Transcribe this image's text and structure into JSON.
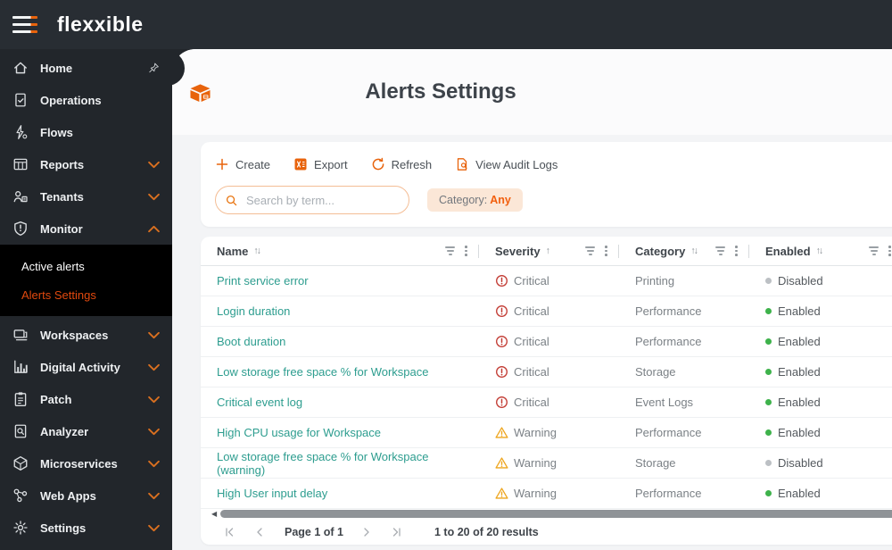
{
  "brand": {
    "logo": "flexxible"
  },
  "sidebar": {
    "primary": [
      {
        "label": "Home",
        "icon": "home",
        "right": "pin"
      },
      {
        "label": "Operations",
        "icon": "operations"
      },
      {
        "label": "Flows",
        "icon": "flows"
      },
      {
        "label": "Reports",
        "icon": "reports",
        "right": "chevron-down"
      },
      {
        "label": "Tenants",
        "icon": "tenants",
        "right": "chevron-down"
      },
      {
        "label": "Monitor",
        "icon": "shield",
        "right": "chevron-up"
      }
    ],
    "submenu": [
      {
        "label": "Active alerts",
        "state": "normal"
      },
      {
        "label": "Alerts Settings",
        "state": "active"
      }
    ],
    "secondary": [
      {
        "label": "Workspaces",
        "icon": "workspaces",
        "right": "chevron-down"
      },
      {
        "label": "Digital Activity",
        "icon": "digital-activity",
        "right": "chevron-down"
      },
      {
        "label": "Patch",
        "icon": "patch",
        "right": "chevron-down"
      },
      {
        "label": "Analyzer",
        "icon": "analyzer",
        "right": "chevron-down"
      },
      {
        "label": "Microservices",
        "icon": "microservices",
        "right": "chevron-down"
      },
      {
        "label": "Web Apps",
        "icon": "web-apps",
        "right": "chevron-down"
      },
      {
        "label": "Settings",
        "icon": "settings",
        "right": "chevron-down"
      }
    ]
  },
  "header": {
    "title": "Alerts Settings",
    "icon": "package"
  },
  "toolbar": {
    "create_label": "Create",
    "export_label": "Export",
    "refresh_label": "Refresh",
    "audit_label": "View Audit Logs"
  },
  "filters": {
    "search_placeholder": "Search by term...",
    "category_label": "Category:",
    "category_value": "Any"
  },
  "table": {
    "columns": [
      {
        "label": "Name",
        "sort": "both"
      },
      {
        "label": "Severity",
        "sort": "asc"
      },
      {
        "label": "Category",
        "sort": "both"
      },
      {
        "label": "Enabled",
        "sort": "both"
      }
    ],
    "rows": [
      {
        "name": "Print service error",
        "severity": "Critical",
        "sevicon": "critical",
        "sevclass": "sev-critical",
        "category": "Printing",
        "status": "Disabled",
        "dot": "dot-off"
      },
      {
        "name": "Login duration",
        "severity": "Critical",
        "sevicon": "critical",
        "sevclass": "sev-critical",
        "category": "Performance",
        "status": "Enabled",
        "dot": "dot-on"
      },
      {
        "name": "Boot duration",
        "severity": "Critical",
        "sevicon": "critical",
        "sevclass": "sev-critical",
        "category": "Performance",
        "status": "Enabled",
        "dot": "dot-on"
      },
      {
        "name": "Low storage free space % for Workspace",
        "severity": "Critical",
        "sevicon": "critical",
        "sevclass": "sev-critical",
        "category": "Storage",
        "status": "Enabled",
        "dot": "dot-on"
      },
      {
        "name": "Critical event log",
        "severity": "Critical",
        "sevicon": "critical",
        "sevclass": "sev-critical",
        "category": "Event Logs",
        "status": "Enabled",
        "dot": "dot-on"
      },
      {
        "name": "High CPU usage for Workspace",
        "severity": "Warning",
        "sevicon": "warning",
        "sevclass": "sev-warning",
        "category": "Performance",
        "status": "Enabled",
        "dot": "dot-on"
      },
      {
        "name": "Low storage free space % for Workspace (warning)",
        "severity": "Warning",
        "sevicon": "warning",
        "sevclass": "sev-warning",
        "category": "Storage",
        "status": "Disabled",
        "dot": "dot-off"
      },
      {
        "name": "High User input delay",
        "severity": "Warning",
        "sevicon": "warning",
        "sevclass": "sev-warning",
        "category": "Performance",
        "status": "Enabled",
        "dot": "dot-on"
      }
    ]
  },
  "pagination": {
    "page_text": "Page 1 of 1",
    "results_text": "1 to 20 of 20 results"
  },
  "colors": {
    "accent_orange": "#e8630c",
    "active_link": "#e1490e",
    "name_link_teal": "#2d9d8f",
    "enabled_green": "#3eb24b",
    "disabled_gray": "#bcc0c4",
    "critical_red": "#c23a32",
    "warning_amber": "#eea51d",
    "topbar_bg": "#282d33",
    "sidebar_bg": "#22262b",
    "submenu_bg": "#000000"
  }
}
